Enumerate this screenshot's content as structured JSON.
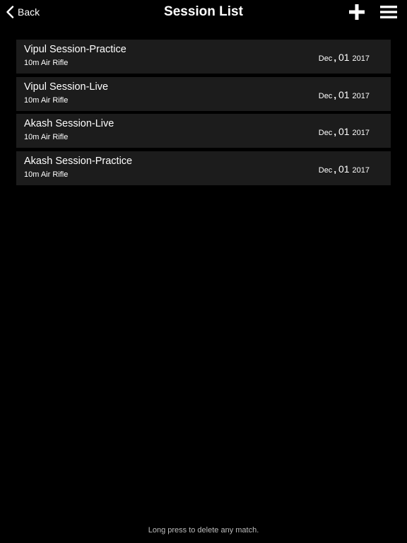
{
  "header": {
    "back_label": "Back",
    "title": "Session List",
    "back_icon": "chevron-left-icon",
    "add_icon": "plus-icon",
    "menu_icon": "hamburger-menu-icon"
  },
  "sessions": [
    {
      "name": "Vipul Session-Practice",
      "type": "10m Air Rifle",
      "date": {
        "month": "Dec",
        "sep": ",",
        "day": "01",
        "year": "2017"
      }
    },
    {
      "name": "Vipul Session-Live",
      "type": "10m Air Rifle",
      "date": {
        "month": "Dec",
        "sep": ",",
        "day": "01",
        "year": "2017"
      }
    },
    {
      "name": "Akash Session-Live",
      "type": "10m Air Rifle",
      "date": {
        "month": "Dec",
        "sep": ",",
        "day": "01",
        "year": "2017"
      }
    },
    {
      "name": "Akash Session-Practice",
      "type": "10m Air Rifle",
      "date": {
        "month": "Dec",
        "sep": ",",
        "day": "01",
        "year": "2017"
      }
    }
  ],
  "footer": {
    "hint": "Long press to delete any match."
  },
  "colors": {
    "background": "#000000",
    "row_background": "#1c1c1c",
    "text": "#ffffff",
    "hint_text": "#bdbdbd"
  }
}
